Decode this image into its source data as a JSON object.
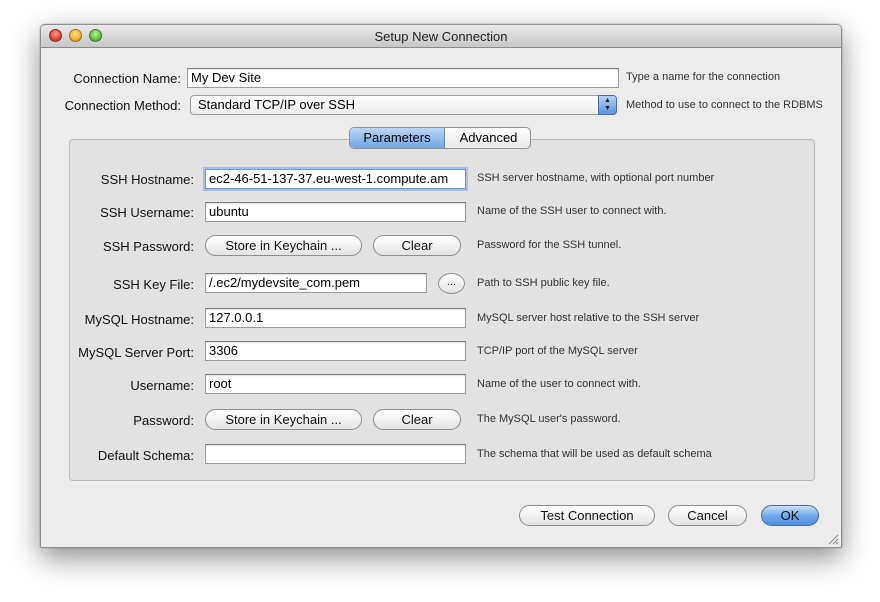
{
  "window": {
    "title": "Setup New Connection"
  },
  "top": {
    "connection_name_label": "Connection Name:",
    "connection_name_value": "My Dev Site",
    "connection_name_hint": "Type a name for the connection",
    "connection_method_label": "Connection Method:",
    "connection_method_value": "Standard TCP/IP over SSH",
    "connection_method_hint": "Method to use to connect to the RDBMS"
  },
  "tabs": {
    "parameters": "Parameters",
    "advanced": "Advanced"
  },
  "ssh": {
    "hostname_label": "SSH Hostname:",
    "hostname_value": "ec2-46-51-137-37.eu-west-1.compute.am",
    "hostname_hint": "SSH server hostname, with  optional port number",
    "username_label": "SSH Username:",
    "username_value": "ubuntu",
    "username_hint": "Name of the SSH user to connect with.",
    "password_label": "SSH Password:",
    "password_store": "Store in Keychain ...",
    "password_clear": "Clear",
    "password_hint": "Password for the SSH tunnel.",
    "keyfile_label": "SSH Key File:",
    "keyfile_value": "/.ec2/mydevsite_com.pem",
    "keyfile_browse": "...",
    "keyfile_hint": "Path to SSH public key file."
  },
  "mysql": {
    "hostname_label": "MySQL Hostname:",
    "hostname_value": "127.0.0.1",
    "hostname_hint": "MySQL server host relative to the SSH server",
    "port_label": "MySQL Server Port:",
    "port_value": "3306",
    "port_hint": "TCP/IP port of the MySQL server",
    "username_label": "Username:",
    "username_value": "root",
    "username_hint": "Name of the user to connect with.",
    "password_label": "Password:",
    "password_store": "Store in Keychain ...",
    "password_clear": "Clear",
    "password_hint": "The MySQL user's password.",
    "schema_label": "Default Schema:",
    "schema_value": "",
    "schema_hint": "The schema that will be used as default schema"
  },
  "footer": {
    "test": "Test Connection",
    "cancel": "Cancel",
    "ok": "OK"
  },
  "colors": {
    "accent": "#6fa6e6",
    "window_bg": "#ececec"
  }
}
